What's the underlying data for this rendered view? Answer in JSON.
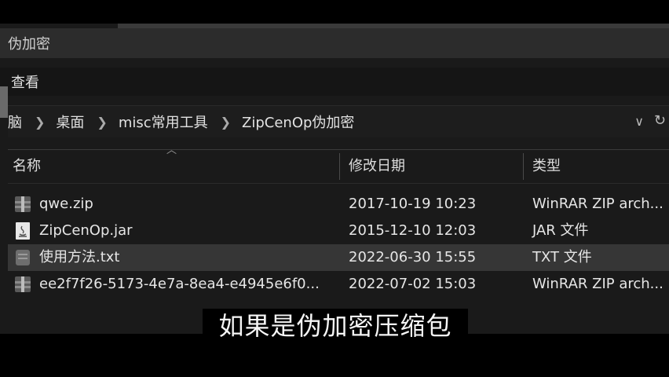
{
  "window": {
    "title": "伪加密"
  },
  "menubar": {
    "view": "查看"
  },
  "address": {
    "crumbs": [
      "脑",
      "桌面",
      "misc常用工具",
      "ZipCenOp伪加密"
    ],
    "dropdown_icon": "chevron-down-icon",
    "refresh_icon": "refresh-icon"
  },
  "columns": {
    "name": "名称",
    "modified": "修改日期",
    "type": "类型"
  },
  "files": [
    {
      "name": "qwe.zip",
      "modified": "2017-10-19 10:23",
      "type": "WinRAR ZIP arch...",
      "icon": "winrar-archive-icon"
    },
    {
      "name": "ZipCenOp.jar",
      "modified": "2015-12-10 12:03",
      "type": "JAR 文件",
      "icon": "java-jar-icon"
    },
    {
      "name": "使用方法.txt",
      "modified": "2022-06-30 15:55",
      "type": "TXT 文件",
      "icon": "text-file-icon"
    },
    {
      "name": "ee2f7f26-5173-4e7a-8ea4-e4945e6f0...",
      "modified": "2022-07-02 15:03",
      "type": "WinRAR ZIP arch...",
      "icon": "winrar-archive-icon"
    }
  ],
  "caption": "如果是伪加密压缩包",
  "colors": {
    "background": "#1a1a1a",
    "highlight_row": "#363636",
    "text": "#e6e6e6"
  }
}
